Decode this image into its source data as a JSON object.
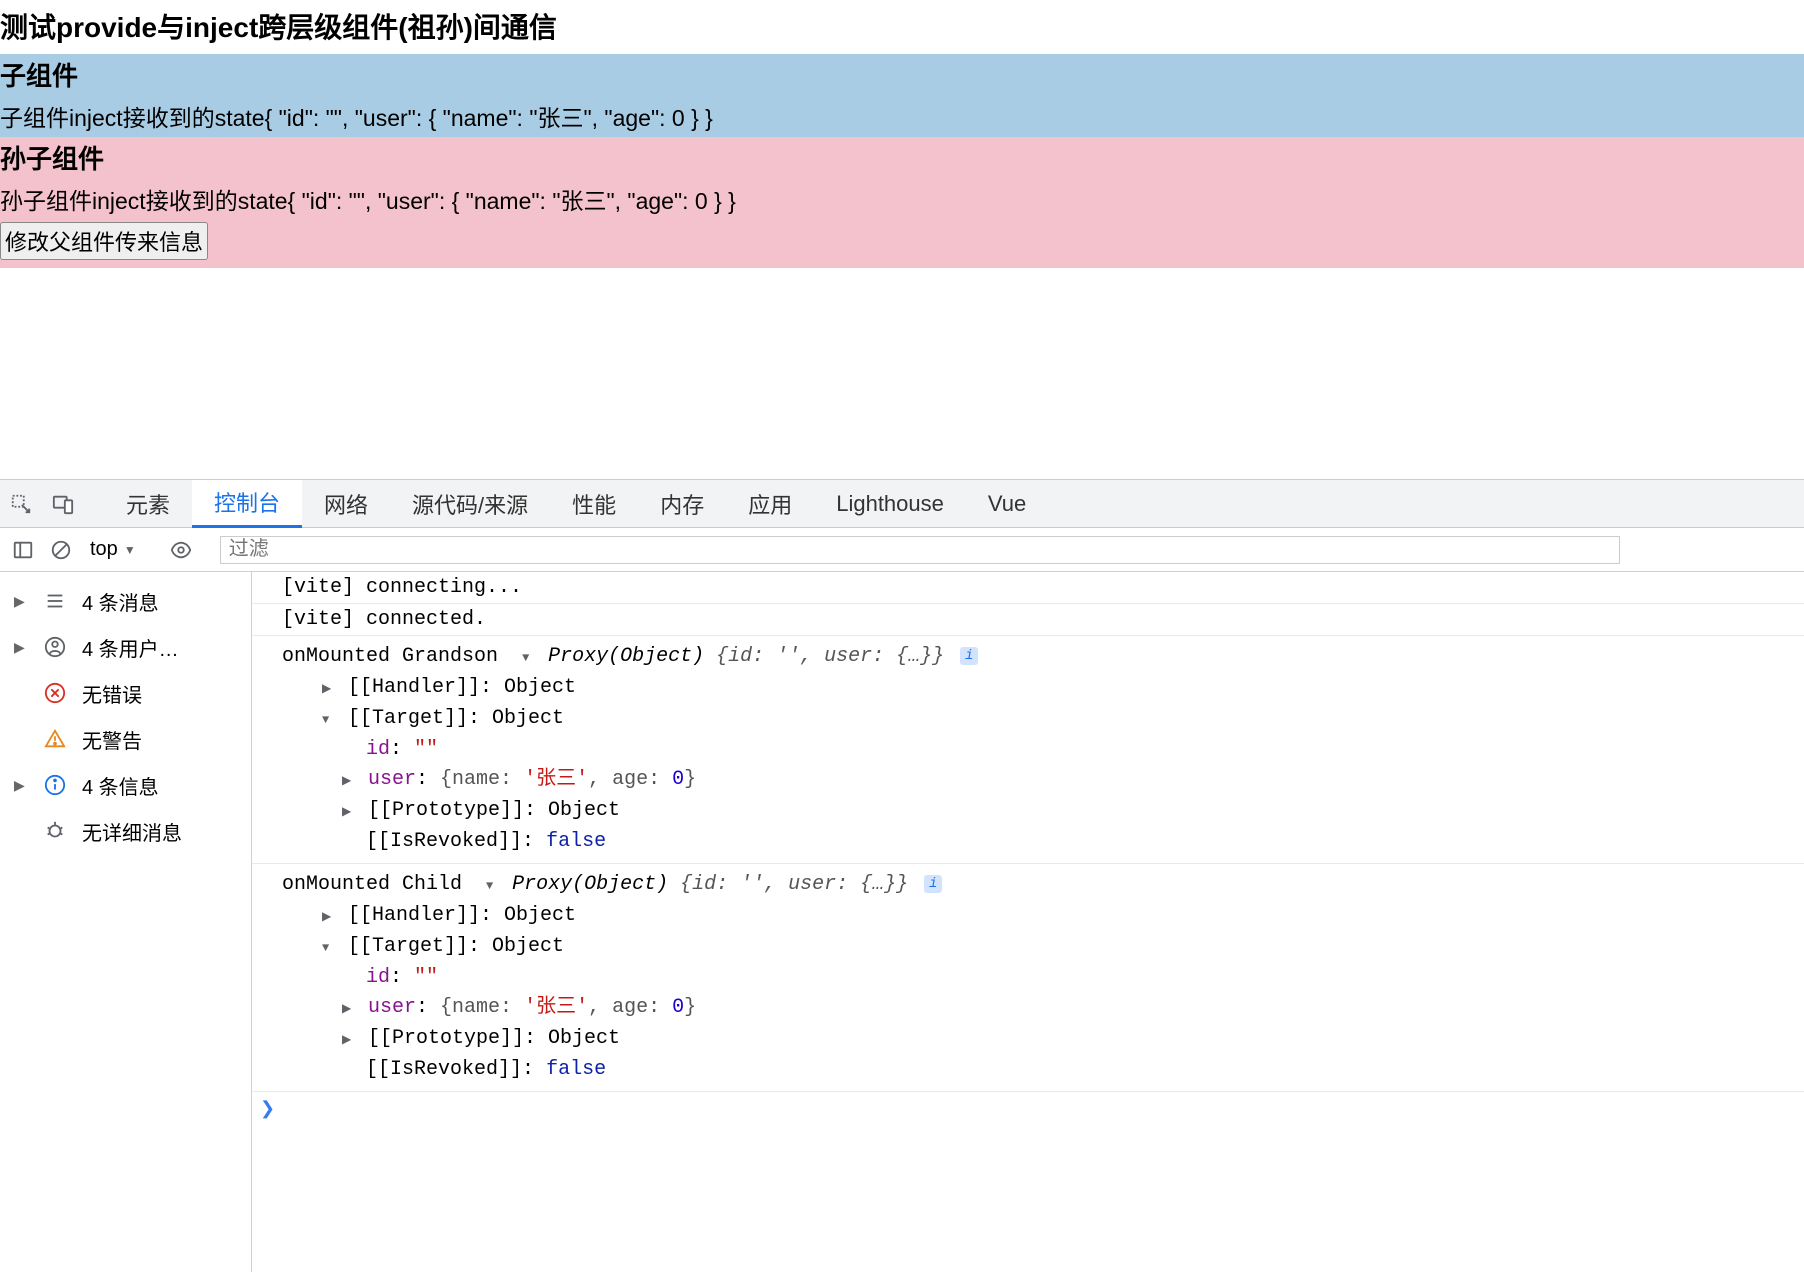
{
  "page": {
    "title": "测试provide与inject跨层级组件(祖孙)间通信",
    "child": {
      "heading": "子组件",
      "text": "子组件inject接收到的state{ \"id\": \"\", \"user\": { \"name\": \"张三\", \"age\": 0 } }"
    },
    "grandchild": {
      "heading": "孙子组件",
      "text": "孙子组件inject接收到的state{ \"id\": \"\", \"user\": { \"name\": \"张三\", \"age\": 0 } }",
      "button": "修改父组件传来信息"
    }
  },
  "devtools": {
    "tabs": {
      "elements": "元素",
      "console": "控制台",
      "network": "网络",
      "sources": "源代码/来源",
      "performance": "性能",
      "memory": "内存",
      "application": "应用",
      "lighthouse": "Lighthouse",
      "vue": "Vue"
    },
    "toolbar": {
      "context": "top",
      "filter_placeholder": "过滤"
    },
    "sidebar": {
      "messages": "4 条消息",
      "user": "4 条用户…",
      "errors": "无错误",
      "warnings": "无警告",
      "info": "4 条信息",
      "verbose": "无详细消息"
    },
    "logs": {
      "vite_connecting": "[vite] connecting...",
      "vite_connected": "[vite] connected.",
      "grandson": {
        "label": "onMounted Grandson",
        "proxy": "Proxy(Object)",
        "summary": "{id: '', user: {…}}",
        "handler": "[[Handler]]: Object",
        "target": "[[Target]]: Object",
        "id_key": "id",
        "id_val": "\"\"",
        "user_key": "user",
        "user_val": "{name: '张三', age: 0}",
        "prototype": "[[Prototype]]: Object",
        "isrevoked_key": "[[IsRevoked]]",
        "isrevoked_val": "false"
      },
      "child": {
        "label": "onMounted Child",
        "proxy": "Proxy(Object)",
        "summary": "{id: '', user: {…}}",
        "handler": "[[Handler]]: Object",
        "target": "[[Target]]: Object",
        "id_key": "id",
        "id_val": "\"\"",
        "user_key": "user",
        "user_val": "{name: '张三', age: 0}",
        "prototype": "[[Prototype]]: Object",
        "isrevoked_key": "[[IsRevoked]]",
        "isrevoked_val": "false"
      }
    }
  }
}
